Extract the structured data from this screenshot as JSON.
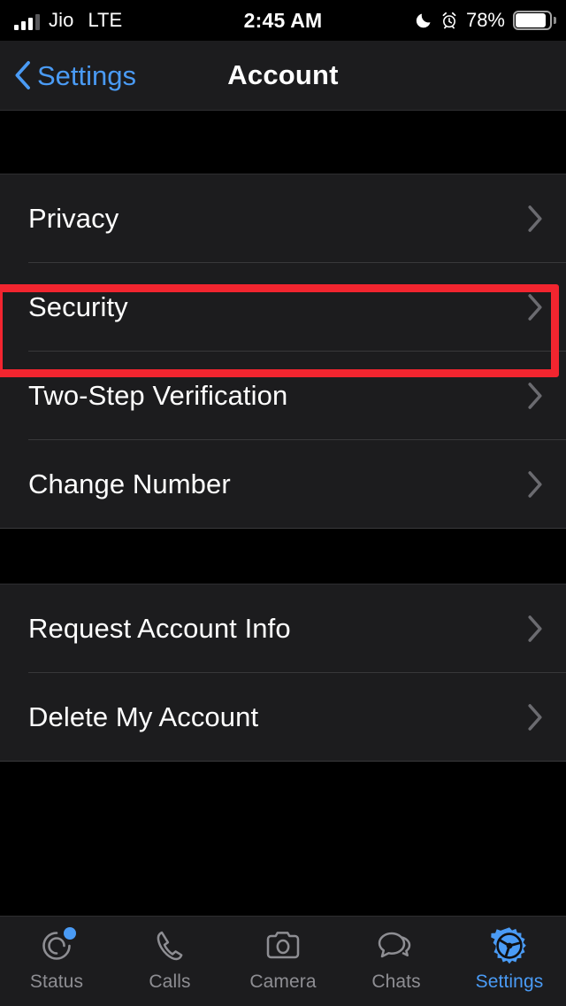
{
  "status_bar": {
    "carrier": "Jio",
    "network": "LTE",
    "time": "2:45 AM",
    "battery_percent": "78%",
    "icons": [
      "signal-bars-icon",
      "moon-dnd-icon",
      "alarm-clock-icon",
      "battery-icon"
    ]
  },
  "nav_bar": {
    "back_label": "Settings",
    "title": "Account"
  },
  "groups": [
    {
      "rows": [
        {
          "label": "Privacy",
          "highlighted": true
        },
        {
          "label": "Security",
          "highlighted": false
        },
        {
          "label": "Two-Step Verification",
          "highlighted": false
        },
        {
          "label": "Change Number",
          "highlighted": false
        }
      ]
    },
    {
      "rows": [
        {
          "label": "Request Account Info",
          "highlighted": false
        },
        {
          "label": "Delete My Account",
          "highlighted": false
        }
      ]
    }
  ],
  "tab_bar": {
    "tabs": [
      {
        "label": "Status",
        "icon": "status-rings-icon",
        "active": false,
        "badge": true
      },
      {
        "label": "Calls",
        "icon": "phone-icon",
        "active": false,
        "badge": false
      },
      {
        "label": "Camera",
        "icon": "camera-icon",
        "active": false,
        "badge": false
      },
      {
        "label": "Chats",
        "icon": "chat-bubbles-icon",
        "active": false,
        "badge": false
      },
      {
        "label": "Settings",
        "icon": "gear-icon",
        "active": true,
        "badge": false
      }
    ]
  },
  "colors": {
    "accent_blue": "#4a9bf5",
    "highlight_red": "#f2252f",
    "row_background": "#1c1c1e",
    "page_background": "#000000",
    "label_white": "#ffffff",
    "inactive_gray": "#8e8e93"
  }
}
